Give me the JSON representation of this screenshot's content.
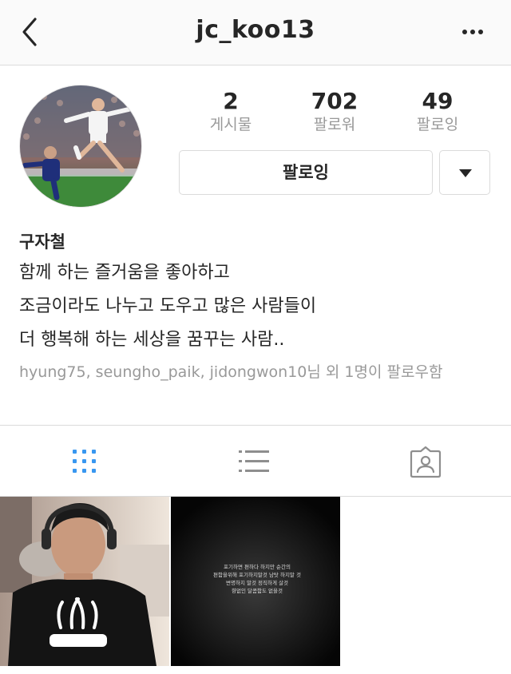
{
  "header": {
    "username": "jc_koo13",
    "back_icon": "chevron-left-icon",
    "more_icon": "more-horizontal-icon"
  },
  "profile": {
    "stats": [
      {
        "value": "2",
        "label": "게시물"
      },
      {
        "value": "702",
        "label": "팔로워"
      },
      {
        "value": "49",
        "label": "팔로잉"
      }
    ],
    "follow_button_label": "팔로잉",
    "dropdown_icon": "triangle-down-icon"
  },
  "bio": {
    "full_name": "구자철",
    "lines": [
      "함께 하는 즐거움을 좋아하고",
      "조금이라도 나누고 도우고 많은 사람들이",
      "더 행복해 하는 세상을 꿈꾸는 사람.."
    ],
    "followed_by": "hyung75, seungho_paik, jidongwon10님 외 1명이 팔로우함"
  },
  "tabs": [
    {
      "icon": "grid-icon",
      "active": true
    },
    {
      "icon": "list-icon",
      "active": false
    },
    {
      "icon": "tagged-person-icon",
      "active": false
    }
  ],
  "posts": {
    "quote_lines": [
      "포기하면 편하다 하지만 순간의",
      "편함을위해 포기하지말것 남탓 하지말 것",
      "변명하지 말것 정직하게 살것",
      "향없인 달콤함도 없을것"
    ]
  },
  "colors": {
    "accent_blue": "#3897f0",
    "muted_text": "#999999",
    "border": "#dbdbdb",
    "text": "#262626"
  }
}
